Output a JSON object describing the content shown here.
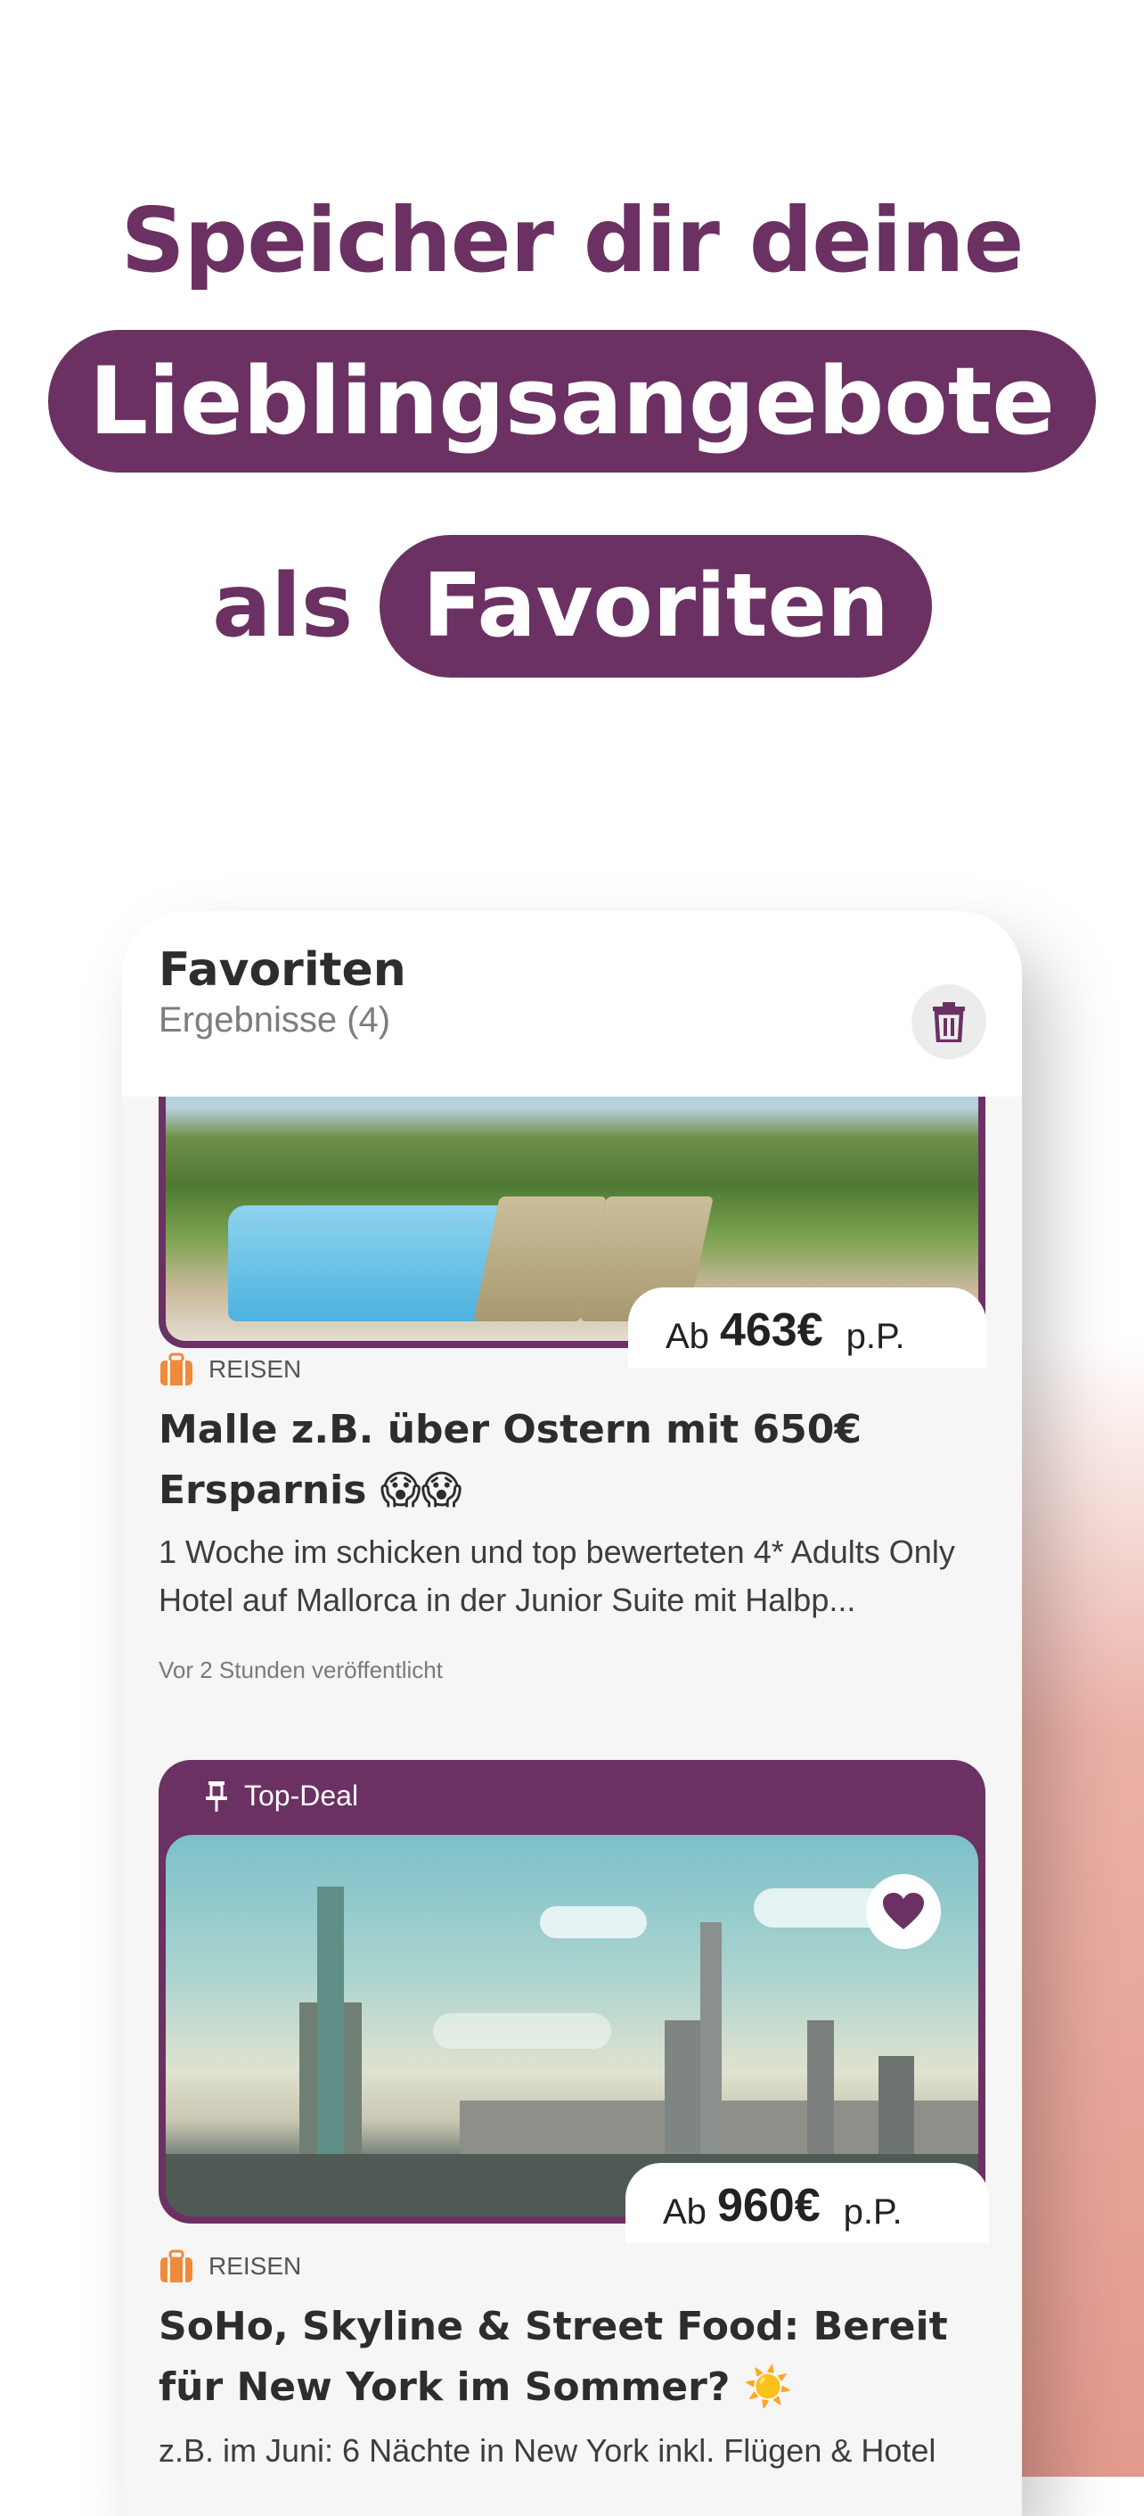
{
  "headline": {
    "line1": "Speicher dir deine",
    "line2_pill": "Lieblingsangebote",
    "line3_text": "als",
    "line3_pill": "Favoriten"
  },
  "favorites": {
    "title": "Favoriten",
    "results": "Ergebnisse (4)",
    "trash_icon": "trash-icon"
  },
  "cards": [
    {
      "price_prefix": "Ab",
      "price": "463€",
      "price_suffix": "p.P.",
      "category": "REISEN",
      "category_icon": "suitcase-icon",
      "title": "Malle z.B. über Ostern mit 650€ Ersparnis 😱😱",
      "description": "1 Woche im schicken und top bewerteten 4* Adults Only Hotel auf Mallorca in der Junior Suite mit Halbp...",
      "published": "Vor 2 Stunden veröffentlicht"
    },
    {
      "label": "Top-Deal",
      "label_icon": "pin-icon",
      "favorite_icon": "heart-icon",
      "price_prefix": "Ab",
      "price": "960€",
      "price_suffix": "p.P.",
      "category": "REISEN",
      "category_icon": "suitcase-icon",
      "title": "SoHo, Skyline & Street Food: Bereit für New York im Sommer? ☀️",
      "description": "z.B. im Juni: 6 Nächte in New York inkl. Flügen & Hotel"
    }
  ],
  "colors": {
    "brand": "#6b3163",
    "category_icon": "#f08a3c"
  }
}
